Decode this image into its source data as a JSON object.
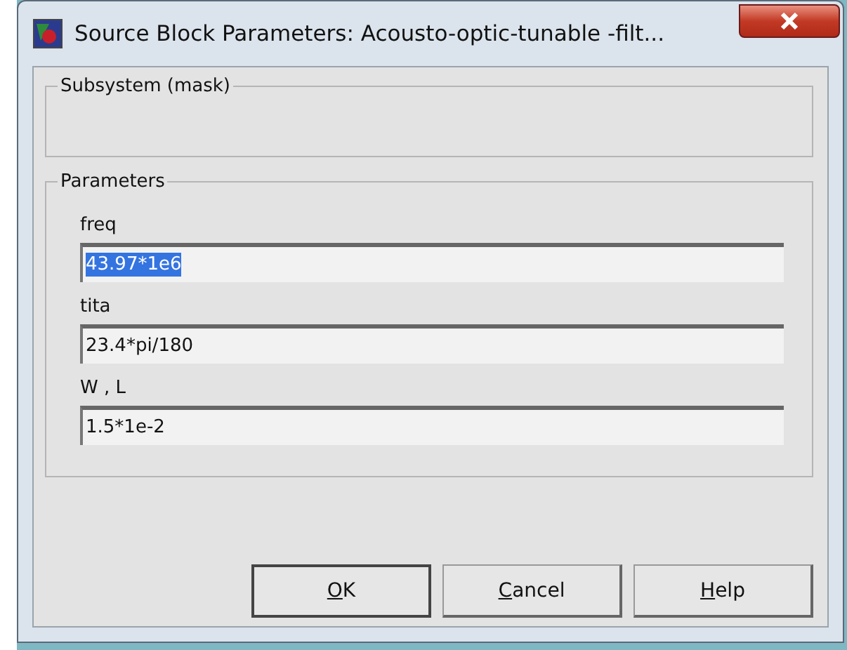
{
  "window": {
    "title": "Source Block Parameters: Acousto-optic-tunable -filt..."
  },
  "description_group": {
    "title": "Subsystem (mask)"
  },
  "parameters_group": {
    "title": "Parameters"
  },
  "parameters": [
    {
      "label": "freq",
      "value": "43.97*1e6",
      "selected": true
    },
    {
      "label": "tita",
      "value": "23.4*pi/180",
      "selected": false
    },
    {
      "label": "W , L",
      "value": "1.5*1e-2",
      "selected": false
    }
  ],
  "buttons": [
    {
      "label": "OK",
      "default": true
    },
    {
      "label": "Cancel",
      "default": false
    },
    {
      "label": "Help",
      "default": false
    }
  ]
}
